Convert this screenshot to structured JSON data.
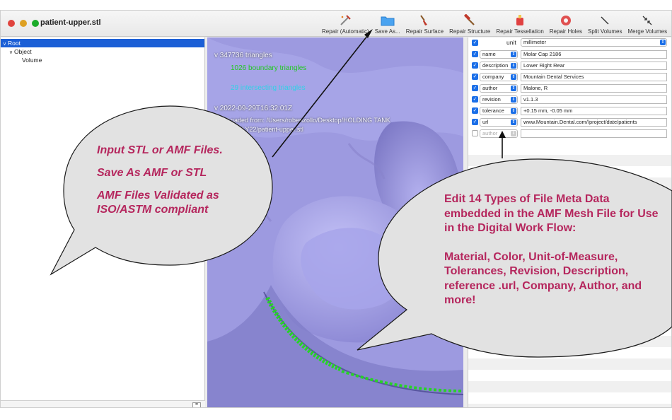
{
  "window": {
    "title": "patient-upper.stl"
  },
  "toolbar": [
    {
      "label": "Repair (Automatic)",
      "icon": "repair-wand-icon"
    },
    {
      "label": "Save As...",
      "icon": "folder-icon"
    },
    {
      "label": "Repair Surface",
      "icon": "brush-icon"
    },
    {
      "label": "Repair Structure",
      "icon": "hammer-icon"
    },
    {
      "label": "Repair Tessellation",
      "icon": "glue-icon"
    },
    {
      "label": "Repair Holes",
      "icon": "tape-icon"
    },
    {
      "label": "Split Volumes",
      "icon": "split-icon"
    },
    {
      "label": "Merge Volumes",
      "icon": "merge-icon"
    }
  ],
  "outline": {
    "items": [
      {
        "label": "Root",
        "chevron": "v",
        "selected": true
      },
      {
        "label": "Object",
        "chevron": "v",
        "selected": false
      },
      {
        "label": "Volume",
        "chevron": "",
        "selected": false
      }
    ],
    "footer_button": "="
  },
  "viewport": {
    "triangles": "347736 triangles",
    "boundary": "1026 boundary triangles",
    "intersecting": "29 intersecting triangles",
    "timestamp": "2022-09-29T16:32:01Z",
    "loaded_from": "Loaded from: /Users/robertzollo/Desktop/HOLDING TANK",
    "loaded_path": "26JULY22/patient-upper.stl",
    "chevron": "v"
  },
  "metadata": {
    "unit_label": "unit",
    "unit_value": "millimeter",
    "rows": [
      {
        "key": "name",
        "value": "Molar Cap 2186",
        "checked": true
      },
      {
        "key": "description",
        "value": "Lower Right Rear",
        "checked": true
      },
      {
        "key": "company",
        "value": "Mountain Dental Services",
        "checked": true
      },
      {
        "key": "author",
        "value": "Malone, R",
        "checked": true
      },
      {
        "key": "revision",
        "value": "v1.1.3",
        "checked": true
      },
      {
        "key": "tolerance",
        "value": "+0.15 mm, -0.05 mm",
        "checked": true
      },
      {
        "key": "url",
        "value": "www.Mountain.Dental.com//project/date/patients",
        "checked": true
      },
      {
        "key": "author",
        "value": "",
        "checked": false
      }
    ]
  },
  "callouts": {
    "left": {
      "line1": "Input STL or AMF Files.",
      "line2": "Save As AMF or STL",
      "line3": "AMF Files Validated as ISO/ASTM compliant"
    },
    "right": {
      "para1": "Edit 14 Types of File Meta Data embedded in the AMF Mesh File for Use in the Digital Work Flow:",
      "para2": "Material, Color, Unit-of-Measure, Tolerances, Revision, Description, reference .url, Company, Author, and more!"
    }
  },
  "colors": {
    "accent": "#1b6fe8",
    "mesh": "#9b98de",
    "callout_text": "#b5265d",
    "callout_fill": "#e2e2e2",
    "boundary_green": "#22c822"
  }
}
